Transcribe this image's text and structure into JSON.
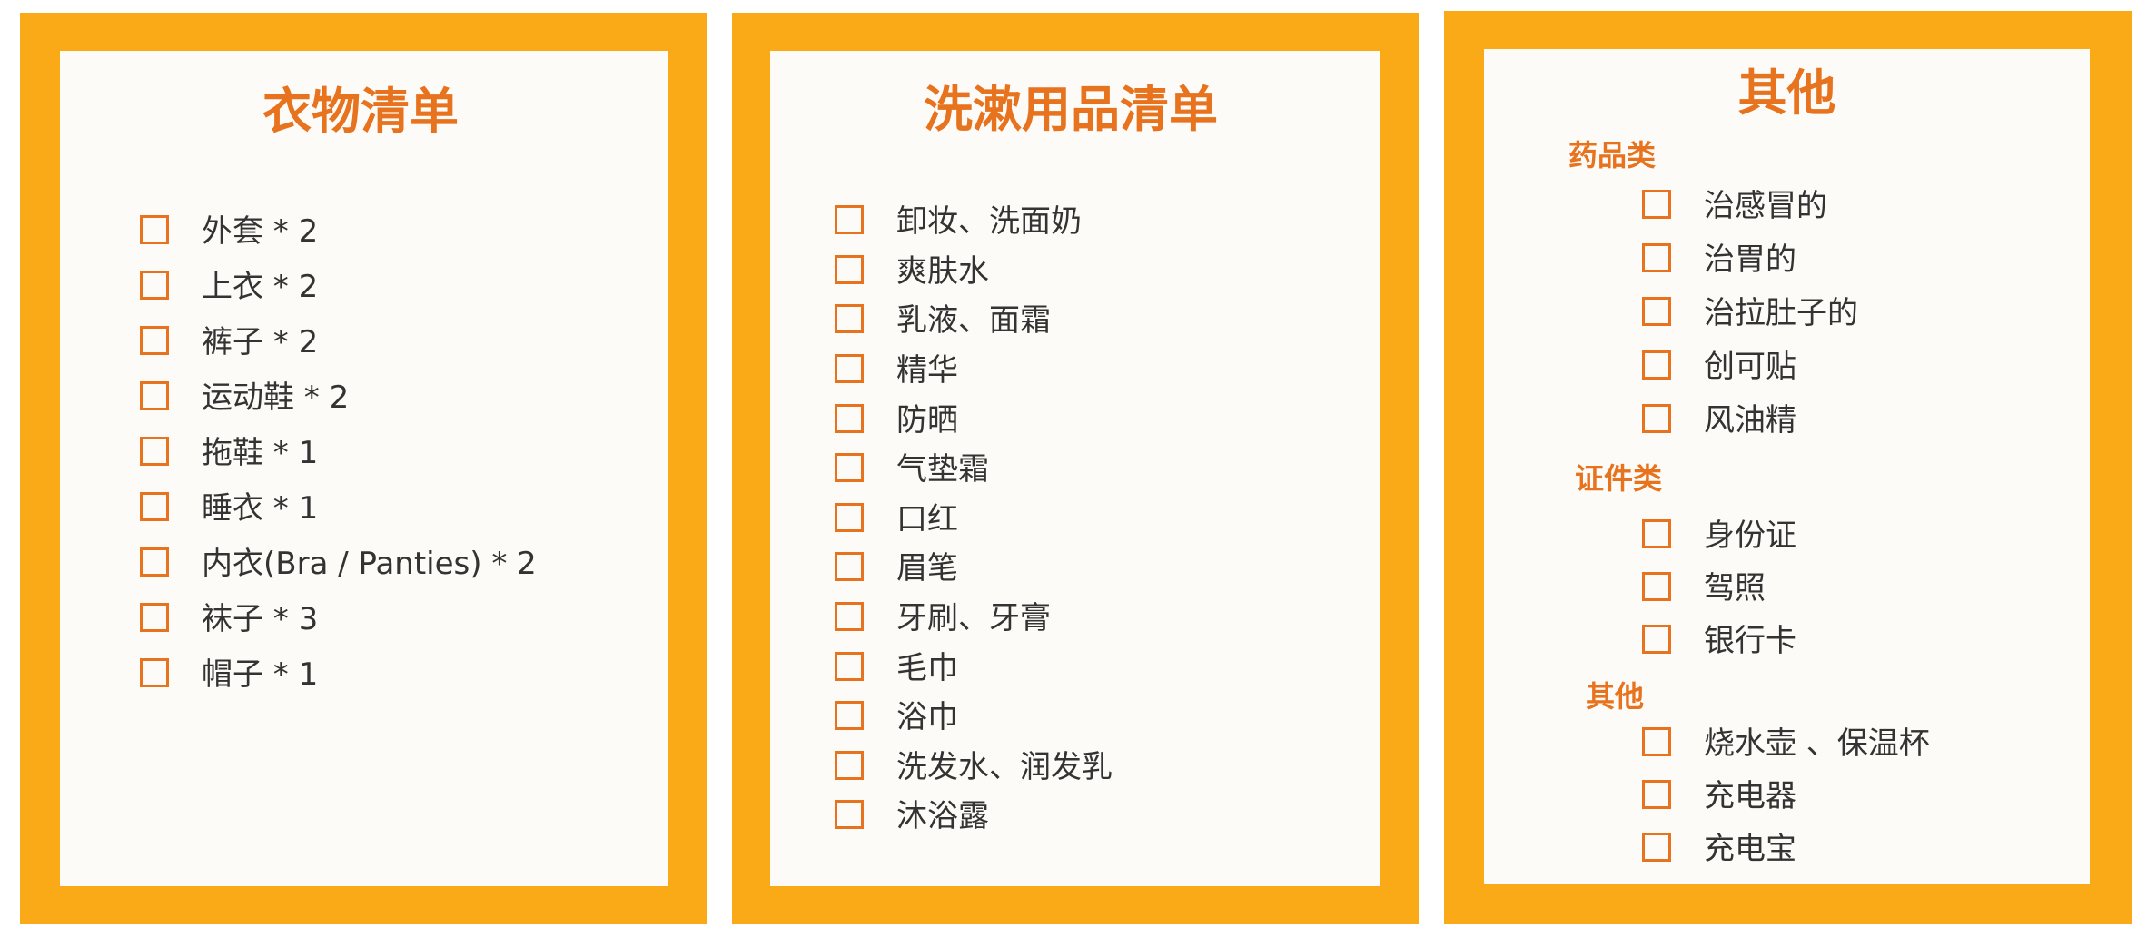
{
  "panels": [
    {
      "title": "衣物清单",
      "items": [
        "外套 * 2",
        "上衣 * 2",
        "裤子 * 2",
        "运动鞋 * 2",
        "拖鞋 * 1",
        "睡衣 * 1",
        "内衣(Bra / Panties) * 2",
        "袜子 * 3",
        "帽子 * 1"
      ]
    },
    {
      "title": "洗漱用品清单",
      "items": [
        "卸妆、洗面奶",
        "爽肤水",
        "乳液、面霜",
        "精华",
        "防晒",
        "气垫霜",
        "口红",
        "眉笔",
        "牙刷、牙膏",
        "毛巾",
        "浴巾",
        "洗发水、润发乳",
        "沐浴露"
      ]
    },
    {
      "title": "其他",
      "sections": [
        {
          "label": "药品类",
          "items": [
            "治感冒的",
            "治胃的",
            "治拉肚子的",
            "创可贴",
            "风油精"
          ]
        },
        {
          "label": "证件类",
          "items": [
            "身份证",
            "驾照",
            "银行卡"
          ]
        },
        {
          "label": "其他",
          "items": [
            "烧水壶 、保温杯",
            "充电器",
            "充电宝"
          ]
        }
      ]
    }
  ],
  "colors": {
    "border": "#fbaa17",
    "paper": "#fcfbf7",
    "accent": "#e8731e",
    "text": "#333333"
  }
}
